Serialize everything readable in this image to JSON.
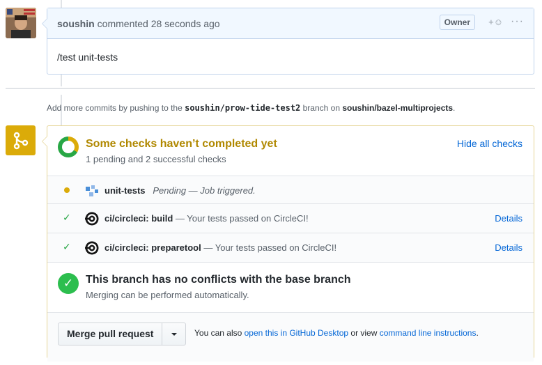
{
  "comment": {
    "author": "soushin",
    "meta": "commented 28 seconds ago",
    "badge": "Owner",
    "reaction": "+☺",
    "more": "···",
    "body": "/test unit-tests"
  },
  "push_hint": {
    "prefix": "Add more commits by pushing to the",
    "branch": "soushin/prow-tide-test2",
    "middle": "branch on",
    "repo": "soushin/bazel-multiprojects",
    "suffix": "."
  },
  "status": {
    "title": "Some checks haven’t completed yet",
    "subtitle": "1 pending and 2 successful checks",
    "toggle_label": "Hide all checks"
  },
  "checks": [
    {
      "state": "pending",
      "name": "unit-tests",
      "description": "Pending — Job triggered.",
      "details": ""
    },
    {
      "state": "success",
      "name": "ci/circleci: build",
      "description": "— Your tests passed on CircleCI!",
      "details": "Details"
    },
    {
      "state": "success",
      "name": "ci/circleci: preparetool",
      "description": "— Your tests passed on CircleCI!",
      "details": "Details"
    }
  ],
  "conflicts": {
    "title": "This branch has no conflicts with the base branch",
    "subtitle": "Merging can be performed automatically."
  },
  "merge": {
    "button_label": "Merge pull request",
    "note_prefix": "You can also",
    "desktop_link": "open this in GitHub Desktop",
    "note_middle": "or view",
    "cli_link": "command line instructions",
    "note_suffix": "."
  },
  "colors": {
    "pending": "#dbab09",
    "success": "#28a745",
    "link": "#0366d6"
  }
}
